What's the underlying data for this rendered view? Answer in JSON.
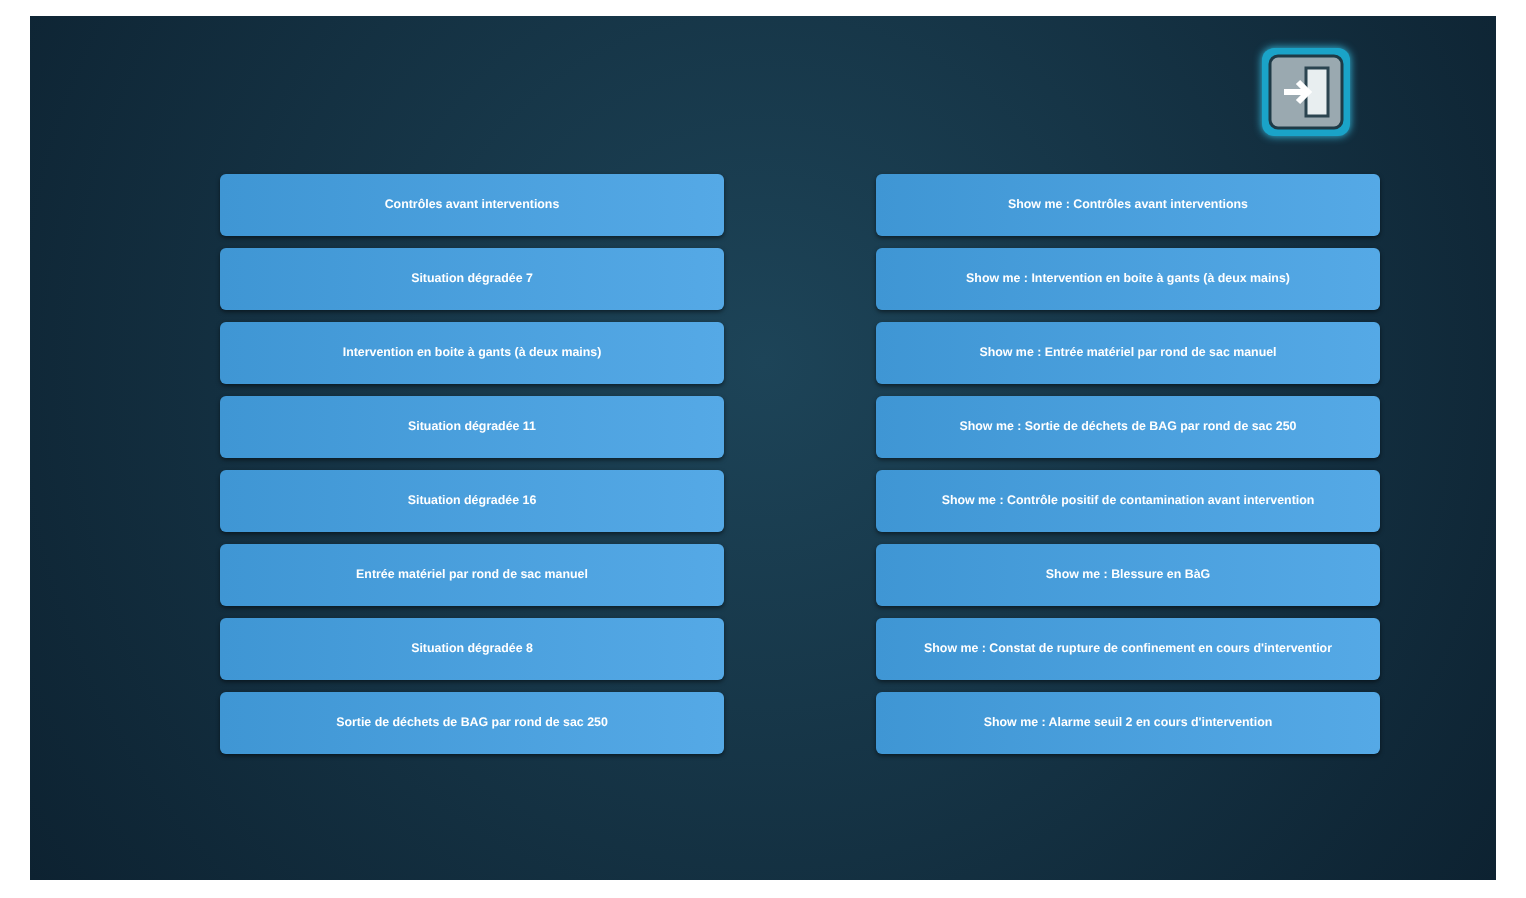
{
  "left_buttons": [
    "Contrôles avant interventions",
    "Situation dégradée 7",
    "Intervention en boite à gants (à deux mains)",
    "Situation dégradée 11",
    "Situation dégradée 16",
    "Entrée matériel par rond de sac  manuel",
    "Situation dégradée 8",
    "Sortie de déchets de BAG par rond de sac 250"
  ],
  "right_buttons": [
    "Show me : Contrôles avant interventions",
    "Show me : Intervention en boite à gants (à deux mains)",
    "Show me : Entrée matériel par rond de sac  manuel",
    "Show me : Sortie de déchets de BAG par rond de sac 250",
    "Show me : Contrôle positif de contamination avant intervention",
    "Show me : Blessure en BàG",
    "Show me : Constat de rupture de confinement en cours d'interventior",
    "Show me : Alarme seuil 2 en cours d'intervention"
  ]
}
